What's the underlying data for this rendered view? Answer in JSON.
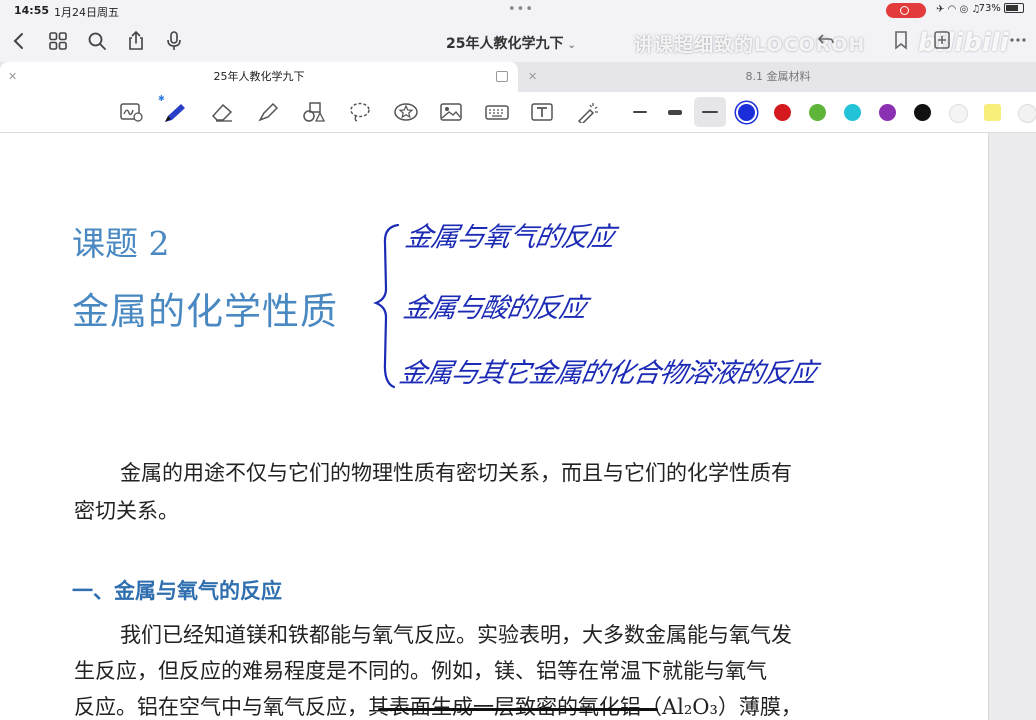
{
  "status_bar": {
    "time": "14:55",
    "date": "1月24日周五",
    "battery": "73%"
  },
  "nav": {
    "doc_title": "25年人教化学九下",
    "caret": "⌄",
    "watermark_text": "讲课超细致的LOCOROH",
    "bili_logo": "bilibili",
    "icons": [
      "back-icon",
      "grid-icon",
      "search-icon",
      "share-icon",
      "mic-icon",
      "undo-icon",
      "bookmark-icon",
      "add-page-icon",
      "more-icon"
    ]
  },
  "tabs": [
    {
      "label": "25年人教化学九下",
      "active": true
    },
    {
      "label": "8.1 金属材料",
      "active": false
    }
  ],
  "toolbar": {
    "tools": [
      "ai-text-icon",
      "pen-icon",
      "eraser-icon",
      "highlighter-icon",
      "shapes-icon",
      "lasso-icon",
      "sticker-icon",
      "image-icon",
      "keyboard-icon",
      "textbox-icon",
      "laser-icon"
    ],
    "colors": [
      "#1a2fd9",
      "#d4191f",
      "#5fb53a",
      "#22c3d6",
      "#8b2fb3",
      "#111111",
      "#f4f4f4",
      "#f7ef7a",
      "#f2f2f2"
    ],
    "selected_color": "#1a2fd9",
    "bluetooth": "✱"
  },
  "page": {
    "lesson_number": "课题 2",
    "lesson_title": "金属的化学性质",
    "handwritten": [
      "金属与氧气的反应",
      "金属与酸的反应",
      "金属与其它金属的化合物溶液的反应"
    ],
    "intro_line1": "金属的用途不仅与它们的物理性质有密切关系，而且与它们的化学性质有",
    "intro_line2": "密切关系。",
    "section_heading": "一、金属与氧气的反应",
    "body_line1": "我们已经知道镁和铁都能与氧气反应。实验表明，大多数金属能与氧气发",
    "body_line2": "生反应，但反应的难易程度是不同的。例如，镁、铝等在常温下就能与氧气",
    "body_line3": "反应。铝在空气中与氧气反应，其表面生成一层致密的氧化铝（Al₂O₃）薄膜，"
  }
}
